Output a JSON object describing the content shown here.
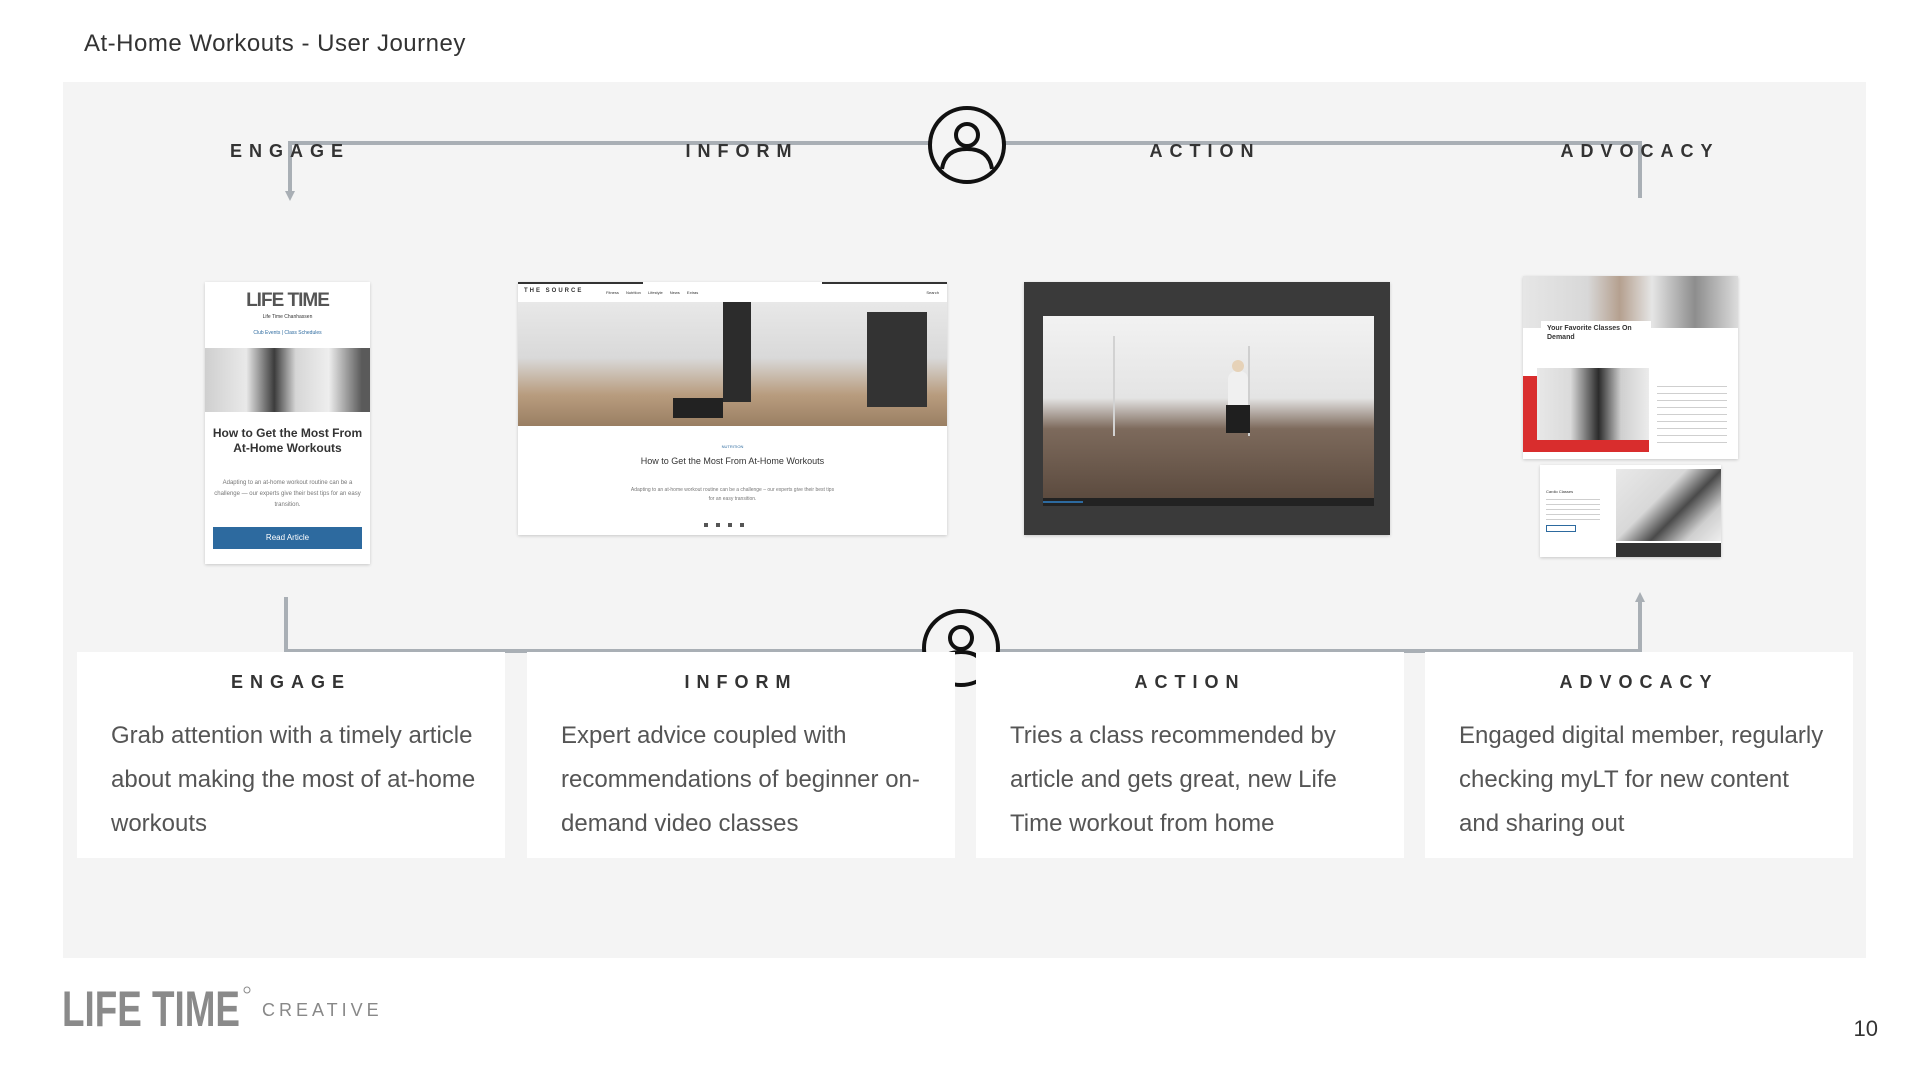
{
  "title": "At-Home Workouts - User Journey",
  "stages": [
    "ENGAGE",
    "INFORM",
    "ACTION",
    "ADVOCACY"
  ],
  "cards": [
    {
      "title": "ENGAGE",
      "body": "Grab attention with a timely article about making the most of at-home workouts"
    },
    {
      "title": "INFORM",
      "body": "Expert advice coupled with recommendations of beginner on-demand video classes"
    },
    {
      "title": "ACTION",
      "body": "Tries a class recommended by article and gets great, new Life Time workout from home"
    },
    {
      "title": "ADVOCACY",
      "body": "Engaged digital member, regularly checking myLT for new content and sharing out"
    }
  ],
  "engage_thumb": {
    "logo": "LIFE TIME",
    "club": "Life Time Chanhassen",
    "links": "Club Events  |  Class Schedules",
    "headline": "How to Get the Most From At-Home Workouts",
    "blurb": "Adapting to an at-home workout routine can be a challenge — our experts give their best tips for an easy transition.",
    "button": "Read Article"
  },
  "inform_thumb": {
    "site": "THE SOURCE",
    "nav": "Fitness  Nutrition  Lifestyle  News  Extras",
    "search": "Search",
    "category": "NUTRITION",
    "headline": "How to Get the Most From At-Home Workouts",
    "blurb": "Adapting to an at-home workout routine can be a challenge – our experts give their best tips for an easy transition."
  },
  "advocacy_thumb": {
    "heading": "Your Favorite Classes On Demand",
    "class_name": "Cardio Classes"
  },
  "footer": {
    "logo": "LIFE TIME",
    "creative": "CREATIVE",
    "page_number": "10"
  },
  "icons": {
    "user_top": "user-circle-icon",
    "user_bottom": "user-circle-icon"
  },
  "colors": {
    "connector": "#a9afb5",
    "panel": "#f4f4f4",
    "button": "#2d6a9f",
    "accent_red": "#d92d2d"
  }
}
